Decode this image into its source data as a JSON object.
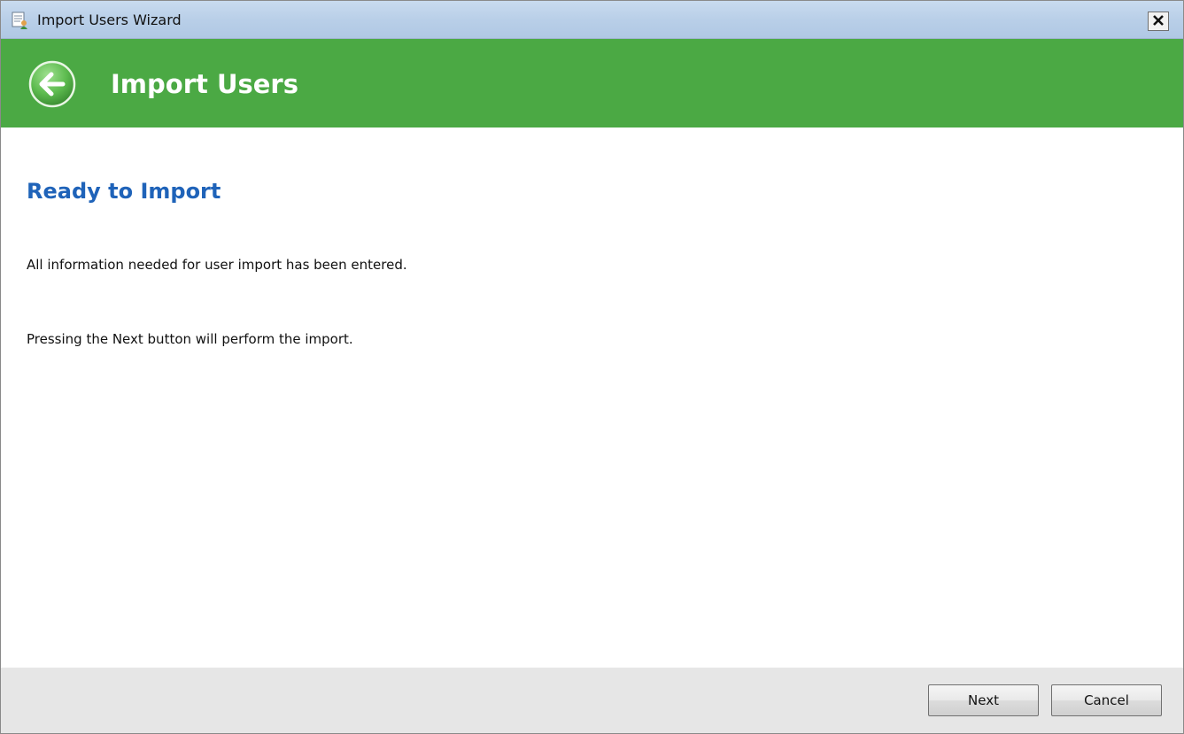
{
  "window": {
    "title": "Import Users Wizard",
    "close_glyph": "×"
  },
  "header": {
    "title": "Import Users",
    "accent_color": "#4ba944",
    "back_icon": "back-arrow-icon"
  },
  "main": {
    "heading": "Ready to Import",
    "heading_color": "#1f63b9",
    "paragraphs": [
      "All information needed for user import has been entered.",
      "Pressing the Next button will perform the import."
    ]
  },
  "footer": {
    "next_label": "Next",
    "cancel_label": "Cancel"
  }
}
